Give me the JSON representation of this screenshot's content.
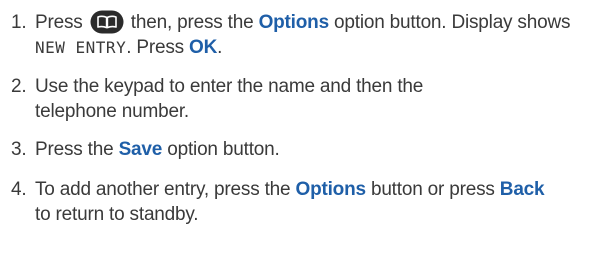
{
  "steps": [
    {
      "number": "1.",
      "press_text": "Press",
      "key_icon": "phonebook-key-icon",
      "then_text": "then, press the",
      "options_label": "Options",
      "option_button_text": "option button. Display shows",
      "display_text": "NEW ENTRY",
      "press_ok_text": ". Press",
      "ok_label": "OK",
      "period": "."
    },
    {
      "number": "2.",
      "text_line1": "Use the keypad to enter the name and then the",
      "text_line2": "telephone number."
    },
    {
      "number": "3.",
      "press_text": "Press the",
      "save_label": "Save",
      "rest_text": "option button."
    },
    {
      "number": "4.",
      "text_before": "To add another entry, press the",
      "options_label": "Options",
      "button_or_text": "button or press",
      "back_label": "Back",
      "text_after": "to return to standby."
    }
  ],
  "colors": {
    "keyword": "#1f5fa8",
    "body_text": "#3a3a3a",
    "key_fill": "#2b2b2b"
  }
}
